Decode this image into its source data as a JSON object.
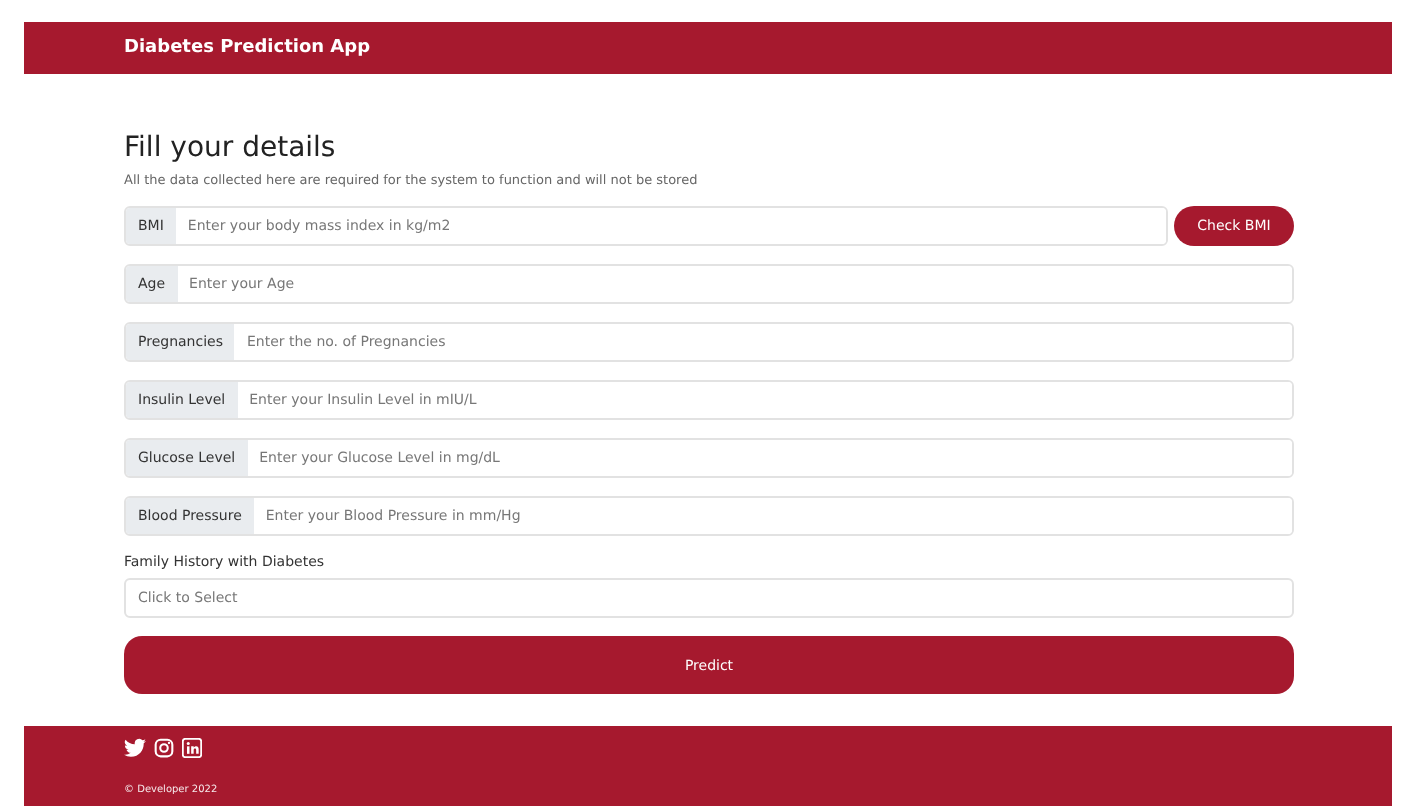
{
  "header": {
    "title": "Diabetes Prediction App"
  },
  "form": {
    "heading": "Fill your details",
    "note": "All the data collected here are required for the system to function and will not be stored",
    "fields": [
      {
        "label": "BMI",
        "placeholder": "Enter your body mass index in kg/m2",
        "action": "Check BMI"
      },
      {
        "label": "Age",
        "placeholder": "Enter your Age"
      },
      {
        "label": "Pregnancies",
        "placeholder": "Enter the no. of Pregnancies"
      },
      {
        "label": "Insulin Level",
        "placeholder": "Enter your Insulin Level in mIU/L"
      },
      {
        "label": "Glucose Level",
        "placeholder": "Enter your Glucose Level in mg/dL"
      },
      {
        "label": "Blood Pressure",
        "placeholder": "Enter your Blood Pressure in mm/Hg"
      }
    ],
    "family": {
      "label": "Family History with Diabetes",
      "placeholder": "Click to Select"
    },
    "submit": "Predict"
  },
  "footer": {
    "socials": [
      {
        "kind": "twitter"
      },
      {
        "kind": "instagram"
      },
      {
        "kind": "linkedin"
      }
    ],
    "copyright": "© Developer 2022"
  }
}
